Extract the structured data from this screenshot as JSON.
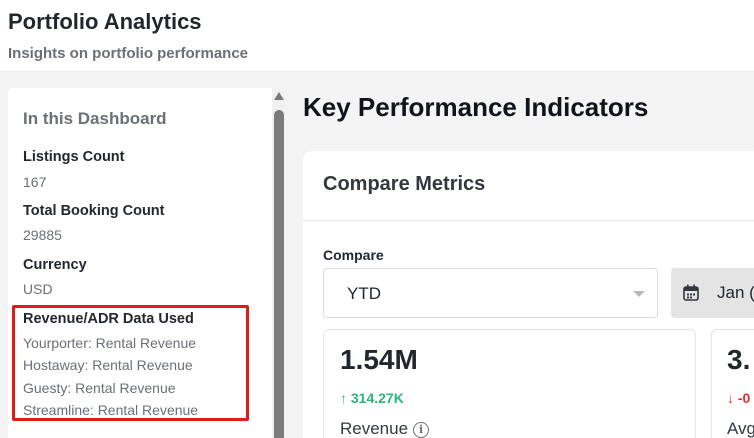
{
  "header": {
    "title": "Portfolio Analytics",
    "subtitle": "Insights on portfolio performance"
  },
  "sidebar": {
    "heading": "In this Dashboard",
    "listings": {
      "label": "Listings Count",
      "value": "167"
    },
    "bookings": {
      "label": "Total Booking Count",
      "value": "29885"
    },
    "currency": {
      "label": "Currency",
      "value": "USD"
    },
    "revenue_data": {
      "label": "Revenue/ADR Data Used",
      "sources": [
        "Yourporter: Rental Revenue",
        "Hostaway: Rental Revenue",
        "Guesty: Rental Revenue",
        "Streamline: Rental Revenue"
      ]
    }
  },
  "main": {
    "title": "Key Performance Indicators",
    "compare_card": {
      "heading": "Compare Metrics",
      "compare_label": "Compare",
      "compare_select_value": "YTD",
      "date_value": "Jan (",
      "metrics": [
        {
          "value": "1.54M",
          "delta": "↑ 314.27K",
          "name": "Revenue"
        },
        {
          "value": "3.",
          "delta": "↓ -0",
          "name": "Avg"
        }
      ]
    }
  },
  "colors": {
    "positive": "#2db67c",
    "negative": "#e03131",
    "highlight": "#e01b1b"
  }
}
